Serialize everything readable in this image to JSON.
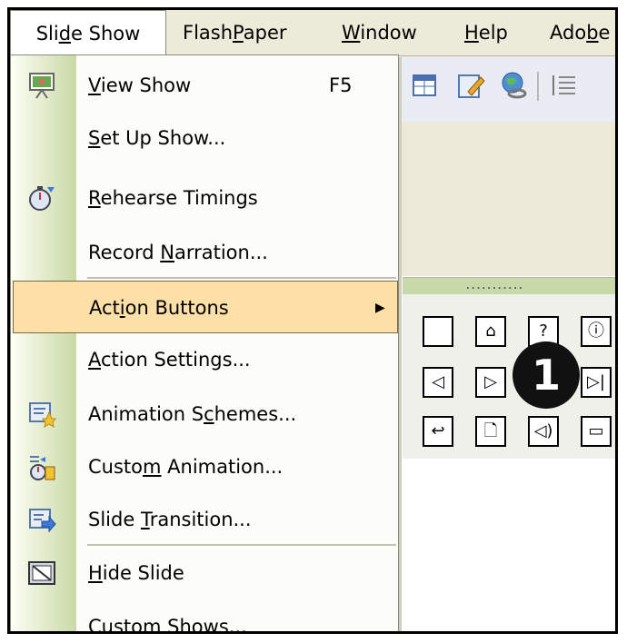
{
  "menubar": {
    "items": [
      {
        "pre": "Sli",
        "ul": "d",
        "post": "e Show"
      },
      {
        "pre": "Flash",
        "ul": "P",
        "post": "aper"
      },
      {
        "pre": "",
        "ul": "W",
        "post": "indow"
      },
      {
        "pre": "",
        "ul": "H",
        "post": "elp"
      },
      {
        "pre": "Ado",
        "ul": "b",
        "post": "e"
      }
    ]
  },
  "menu": {
    "items": [
      {
        "pre": "",
        "ul": "V",
        "post": "iew Show",
        "shortcut": "F5",
        "icon": "projector-screen-icon"
      },
      {
        "pre": "",
        "ul": "S",
        "post": "et Up Show...",
        "icon": ""
      },
      {
        "pre": "",
        "ul": "R",
        "post": "ehearse Timings",
        "icon": "stopwatch-icon"
      },
      {
        "pre": "Record ",
        "ul": "N",
        "post": "arration...",
        "icon": ""
      },
      {
        "pre": "Act",
        "ul": "i",
        "post": "on Buttons",
        "arrow": "▶",
        "icon": ""
      },
      {
        "pre": "",
        "ul": "A",
        "post": "ction Settings...",
        "icon": ""
      },
      {
        "pre": "Animation S",
        "ul": "c",
        "post": "hemes...",
        "icon": "animation-schemes-icon"
      },
      {
        "pre": "Custo",
        "ul": "m",
        "post": " Animation...",
        "icon": "custom-animation-icon"
      },
      {
        "pre": "Slide ",
        "ul": "T",
        "post": "ransition...",
        "icon": "slide-transition-icon"
      },
      {
        "pre": "",
        "ul": "H",
        "post": "ide Slide",
        "icon": "hide-slide-icon"
      },
      {
        "pre": "Custom Sho",
        "ul": "w",
        "post": "s...",
        "icon": ""
      }
    ]
  },
  "palette": {
    "grip": "...........",
    "buttons": [
      {
        "name": "custom-button",
        "glyph": ""
      },
      {
        "name": "home-button",
        "glyph": "⌂"
      },
      {
        "name": "help-button",
        "glyph": "?"
      },
      {
        "name": "information-button",
        "glyph": "ⓘ"
      },
      {
        "name": "back-button",
        "glyph": "◁"
      },
      {
        "name": "forward-button",
        "glyph": "▷"
      },
      {
        "name": "beginning-button",
        "glyph": ""
      },
      {
        "name": "end-button",
        "glyph": "▷|"
      },
      {
        "name": "return-button",
        "glyph": "↩"
      },
      {
        "name": "document-button",
        "glyph": "🗋"
      },
      {
        "name": "sound-button",
        "glyph": "◁)"
      },
      {
        "name": "movie-button",
        "glyph": "▭"
      }
    ]
  },
  "callout": {
    "label": "1"
  }
}
